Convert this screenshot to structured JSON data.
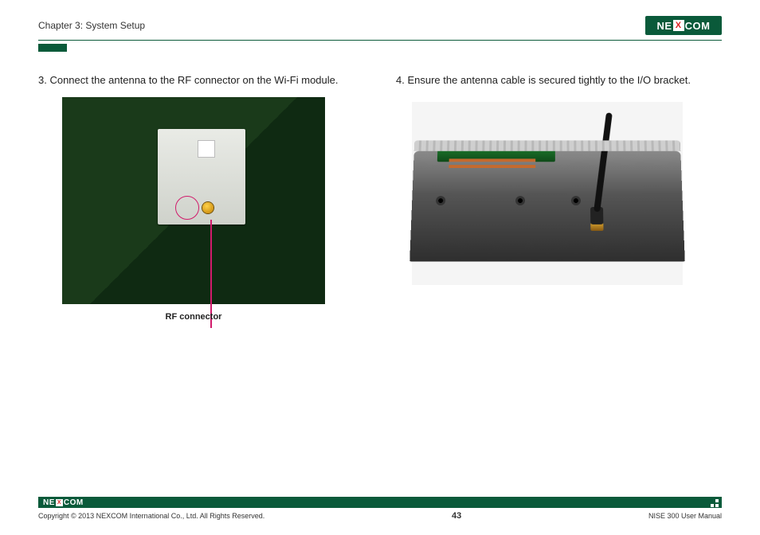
{
  "header": {
    "chapter": "Chapter 3: System Setup",
    "logo_pre": "NE",
    "logo_x": "X",
    "logo_post": "COM"
  },
  "left": {
    "step_text": "3. Connect the antenna to the RF connector on the Wi-Fi module.",
    "callout_label": "RF connector"
  },
  "right": {
    "step_text": "4. Ensure the antenna cable is secured tightly to the I/O bracket."
  },
  "footer": {
    "logo_pre": "NE",
    "logo_x": "X",
    "logo_post": "COM",
    "copyright": "Copyright © 2013 NEXCOM International Co., Ltd. All Rights Reserved.",
    "page_number": "43",
    "doc_title": "NISE 300 User Manual"
  }
}
